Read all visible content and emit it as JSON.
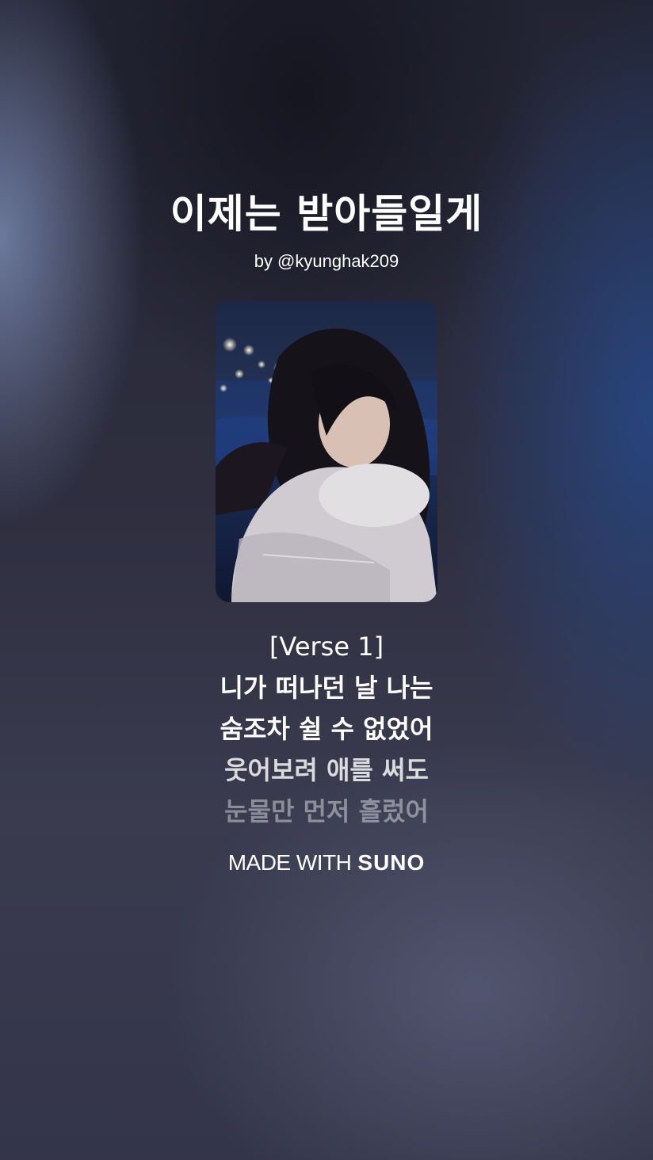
{
  "song": {
    "title": "이제는 받아들일게",
    "byline": "by @kyunghak209"
  },
  "cover": {
    "icon": "cover-art-image"
  },
  "lyrics": [
    "[Verse 1]",
    "니가 떠나던 날 나는",
    "숨조차 쉴 수 없었어",
    "웃어보려 애를 써도",
    "눈물만 먼저 흘렀어"
  ],
  "footer": {
    "made_with": "MADE WITH",
    "brand": "SUNO"
  },
  "colors": {
    "text": "#ffffff",
    "accent_blue": "#284682"
  }
}
